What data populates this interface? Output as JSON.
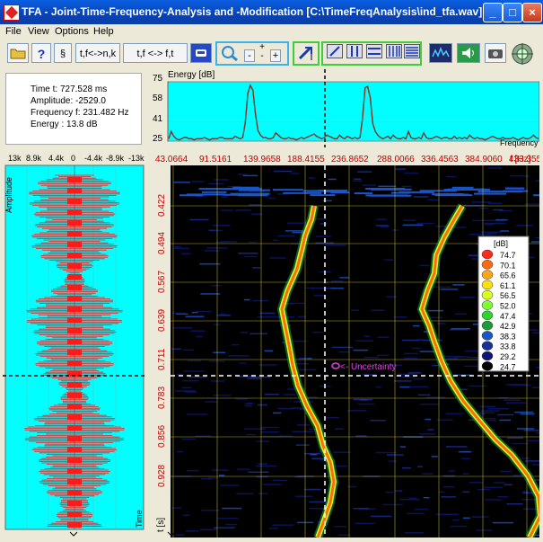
{
  "window": {
    "title": "TFA - Joint-Time-Frequency-Analysis and -Modification [C:\\TimeFreqAnalysis\\ind_tfa.wav]",
    "minimize": "_",
    "maximize": "□",
    "close": "×"
  },
  "menu": [
    {
      "label": "File"
    },
    {
      "label": "View"
    },
    {
      "label": "Options"
    },
    {
      "label": "Help"
    }
  ],
  "toolbar": {
    "transform_tn": "t,f<->n,k",
    "transform_tf": "t,f <-> f,t",
    "zoom_minus": "-",
    "zoom_plus": "+",
    "zoom_small_plus": "+"
  },
  "info": {
    "time": "Time t: 727.528 ms",
    "amplitude": "Amplitude: -2529.0",
    "frequency": "Frequency f: 231.482 Hz",
    "energy": "Energy : 13.8 dB"
  },
  "energy": {
    "label": "Energy [dB]",
    "y_ticks": [
      "75",
      "58",
      "41",
      "25"
    ],
    "x_label": "Frequency",
    "values": [
      27,
      33,
      29,
      27,
      26,
      27,
      28,
      28,
      27,
      27,
      26,
      27,
      27,
      27,
      28,
      27,
      26,
      27,
      27,
      27,
      28,
      28,
      27,
      27,
      27,
      27,
      29,
      28,
      27,
      28,
      40,
      65,
      72,
      68,
      48,
      34,
      30,
      28,
      28,
      27,
      27,
      28,
      32,
      30,
      28,
      27,
      27,
      28,
      27,
      27,
      26,
      27,
      28,
      27,
      28,
      29,
      30,
      31,
      29,
      28,
      27,
      28,
      30,
      29,
      28,
      27,
      27,
      30,
      28,
      27,
      29,
      28,
      27,
      28,
      27,
      28,
      44,
      70,
      71,
      62,
      40,
      33,
      30,
      28,
      27,
      28,
      29,
      27,
      30,
      28,
      27,
      27,
      28,
      27,
      33,
      28,
      27,
      27,
      28,
      27,
      32,
      28,
      27,
      27,
      28,
      29,
      28,
      27,
      28,
      28,
      27,
      27,
      29,
      27,
      28,
      27,
      28,
      27,
      30,
      28,
      27,
      28,
      27,
      27,
      26,
      27,
      28,
      29,
      28,
      27,
      27,
      28,
      27,
      27,
      27,
      28,
      27,
      26,
      27,
      28,
      27,
      27,
      28,
      30,
      28,
      27
    ]
  },
  "amplitude_panel": {
    "y_label": "Amplitude",
    "x_ticks": [
      "13k",
      "8.9k",
      "4.4k",
      "0",
      "-4.4k",
      "-8.9k",
      "-13k"
    ],
    "t_label": "Time"
  },
  "tfa": {
    "freq_ticks": [
      "43.0664",
      "91.5161",
      "139.9658",
      "188.4155",
      "236.8652",
      "288.0066",
      "336.4563",
      "384.9060",
      "433.3557"
    ],
    "freq_unit": "f [Hz]",
    "time_ticks": [
      "0.422",
      "0.494",
      "0.567",
      "0.639",
      "0.711",
      "0.783",
      "0.856",
      "0.928"
    ],
    "time_unit": "t [s]",
    "uncertainty_label": "<- Uncertainty",
    "colorbar": {
      "unit": "[dB]",
      "levels": [
        "74.7",
        "70.1",
        "65.6",
        "61.1",
        "56.5",
        "52.0",
        "47.4",
        "42.9",
        "38.3",
        "33.8",
        "29.2",
        "24.7"
      ],
      "colors": [
        "#ff2a1a",
        "#ff6a14",
        "#ffa514",
        "#ffdf14",
        "#d8ff20",
        "#7dff30",
        "#2fd52f",
        "#1d9a3a",
        "#1a55c8",
        "#1a2e9a",
        "#0c1870",
        "#000000"
      ]
    },
    "cursor": {
      "time_s": 0.7275,
      "freq_hz": 231.5
    }
  }
}
